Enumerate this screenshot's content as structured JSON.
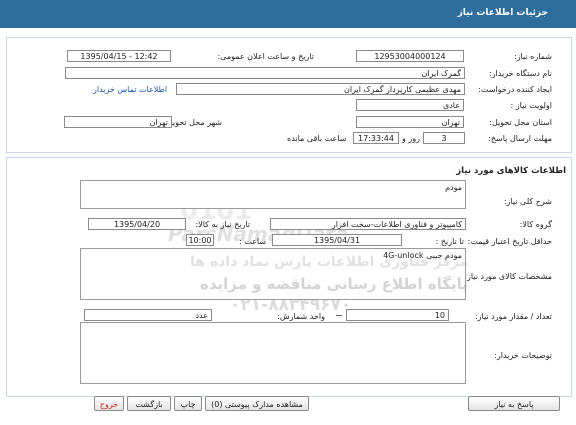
{
  "window": {
    "title": "جزئیات اطلاعات نیاز"
  },
  "info": {
    "need_number_label": "شماره نیاز:",
    "need_number": "12953004000124",
    "announce_label": "تاریخ و ساعت اعلان عمومی:",
    "announce_value": "1395/04/15 - 12:42",
    "buyer_label": "نام دستگاه خریدار:",
    "buyer_value": "گمرک ایران",
    "creator_label": "ایجاد کننده درخواست:",
    "creator_value": "مهدی عظیمی کارپرداز گمرک ایران",
    "contact_link": "اطلاعات تماس خریدار",
    "priority_label": "اولویت نیاز :",
    "priority_value": "عادی",
    "province_label": "استان محل تحویل:",
    "province_value": "تهران",
    "city_label": "شهر محل تحویل:",
    "city_value": "تهران",
    "deadline_label": "مهلت ارسال پاسخ:",
    "deadline_days": "3",
    "day_and": "روز و",
    "deadline_time": "17:33:44",
    "remaining_label": "ساعت باقی مانده"
  },
  "goods": {
    "section_title": "اطلاعات کالاهای مورد نیاز",
    "summary_label": "شرح کلی نیاز:",
    "summary_value": "مودم",
    "group_label": "گروه کالا:",
    "group_value": "کامپیوتر و فناوری اطلاعات-سخت افزار",
    "need_date_label": "تاریخ نیاز به کالا:",
    "need_date_value": "1395/04/20",
    "min_validity_label": "حداقل تاریخ اعتبار قیمت:",
    "until_date_label": "تا تاریخ :",
    "until_date_value": "1395/04/31",
    "time_label": "ساعت :",
    "time_value": "10:00",
    "specs_label": "مشخصات کالای مورد نیاز:",
    "specs_value": "مودم جیبی 4G-unlock",
    "qty_label": "تعداد / مقدار مورد نیاز:",
    "qty_value": "10",
    "unit_label": "واحد شمارش:",
    "unit_value": "عدد",
    "notes_label": "توضیحات خریدار:",
    "notes_value": ""
  },
  "watermark": {
    "line1": "مرکز فناوری اطلاعات پارس نماد داده ها",
    "line2": "پایگاه اطلاع رسانی مناقصه و مزایده",
    "line3": "۰۲۱-۸۸۳۴۹۶۷۰",
    "brand": "ParsNamadData"
  },
  "buttons": {
    "reply": "پاسخ به نیاز",
    "attachments": "مشاهده مدارک پیوستی (0)",
    "print": "چاپ",
    "back": "بازگشت",
    "exit": "خروج"
  }
}
